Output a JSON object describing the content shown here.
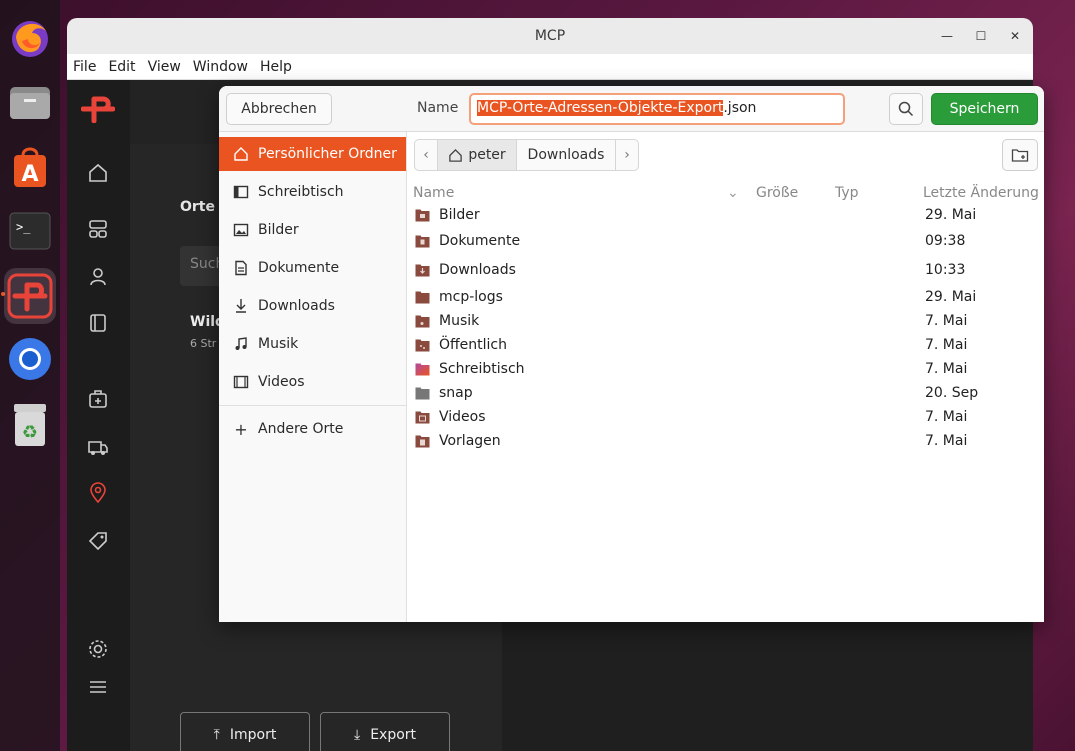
{
  "window": {
    "title": "MCP"
  },
  "menu": [
    "File",
    "Edit",
    "View",
    "Window",
    "Help"
  ],
  "app": {
    "panel_title": "Orte",
    "search_placeholder": "Such",
    "list_item_title": "Wild",
    "list_item_sub": "6 Str",
    "import_label": "Import",
    "export_label": "Export"
  },
  "dialog": {
    "cancel_label": "Abbrechen",
    "name_label": "Name",
    "filename_selected": "MCP-Orte-Adressen-Objekte-Export",
    "filename_ext": ".json",
    "save_label": "Speichern",
    "places": [
      {
        "label": "Persönlicher Ordner",
        "icon": "home-icon",
        "active": true
      },
      {
        "label": "Schreibtisch",
        "icon": "desktop-icon"
      },
      {
        "label": "Bilder",
        "icon": "image-icon"
      },
      {
        "label": "Dokumente",
        "icon": "document-icon"
      },
      {
        "label": "Downloads",
        "icon": "download-icon"
      },
      {
        "label": "Musik",
        "icon": "music-icon"
      },
      {
        "label": "Videos",
        "icon": "video-icon"
      }
    ],
    "other_places": "Andere Orte",
    "path": {
      "home": "peter",
      "current": "Downloads"
    },
    "columns": {
      "name": "Name",
      "size": "Größe",
      "type": "Typ",
      "modified": "Letzte Änderung"
    },
    "files": [
      {
        "name": "Bilder",
        "modified": "29. Mai"
      },
      {
        "name": "Dokumente",
        "modified": "09:38"
      },
      {
        "name": "Downloads",
        "modified": "10:33"
      },
      {
        "name": "mcp-logs",
        "modified": "29. Mai"
      },
      {
        "name": "Musik",
        "modified": "7. Mai"
      },
      {
        "name": "Öffentlich",
        "modified": "7. Mai"
      },
      {
        "name": "Schreibtisch",
        "modified": "7. Mai"
      },
      {
        "name": "snap",
        "modified": "20. Sep"
      },
      {
        "name": "Videos",
        "modified": "7. Mai"
      },
      {
        "name": "Vorlagen",
        "modified": "7. Mai"
      }
    ]
  },
  "colors": {
    "accent": "#e95420",
    "save": "#2a9d3a"
  }
}
